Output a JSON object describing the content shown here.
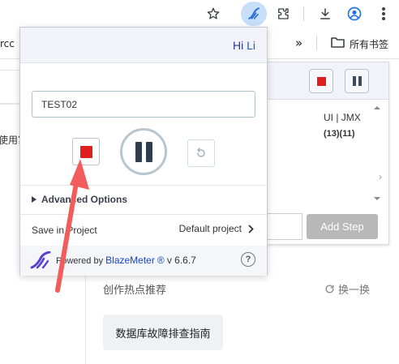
{
  "toolbar": {
    "icons": [
      "star-icon",
      "blazemeter-extension-icon",
      "extensions-puzzle-icon",
      "download-icon",
      "profile-icon",
      "more-vert-icon"
    ]
  },
  "bookmarks": {
    "left_fragment": "rcc",
    "overflow": "»",
    "folder_label": "所有书签"
  },
  "background": {
    "left_text_fragment": "使用富",
    "hot_title": "创作热点推荐",
    "refresh_label": "换一换",
    "tag_label": "数据库故障排查指南"
  },
  "back_panel": {
    "format_label": "UI | JMX",
    "counts": "(13)(11)",
    "add_step_label": "Add Step"
  },
  "popup": {
    "greeting_prefix": "Hi",
    "greeting_name": "Li",
    "test_name_value": "TEST02",
    "advanced_label": "Advanced Options",
    "save_in_label": "Save in Project",
    "project_value": "Default project",
    "powered_prefix": "Powered by",
    "brand": "BlazeMeter",
    "registered": "®",
    "version": "v 6.6.7",
    "help_label": "?"
  },
  "colors": {
    "stop_red": "#e01e1e",
    "brand_blue": "#1447c8",
    "arrow_red": "#f25c5c"
  }
}
